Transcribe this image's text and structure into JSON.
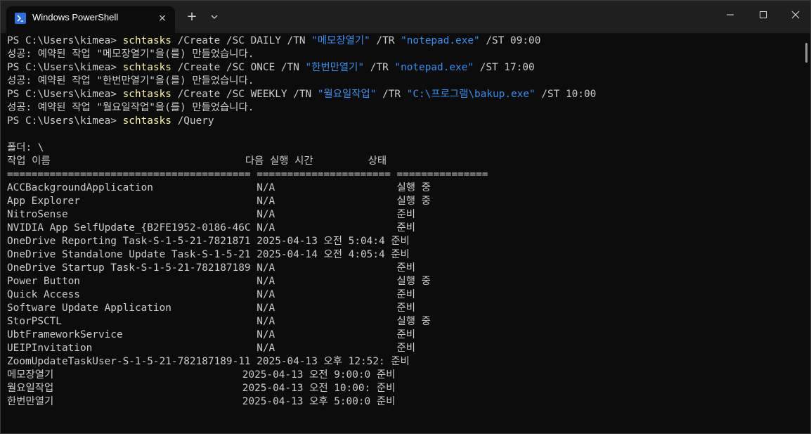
{
  "window": {
    "tab_title": "Windows PowerShell",
    "tab_close_icon": "×",
    "new_tab_icon": "+",
    "dropdown_icon": "chevron-down-icon",
    "controls": [
      "minimize-icon",
      "maximize-icon",
      "close-icon"
    ]
  },
  "colors": {
    "background": "#0c0c0c",
    "text": "#cccccc",
    "command": "#f9f1a5",
    "string": "#3b8eea",
    "titlebar": "#1f1f1f"
  },
  "terminal": {
    "lines": [
      {
        "segments": [
          {
            "text": "PS C:\\Users\\kimea> ",
            "style": "plain"
          },
          {
            "text": "schtasks",
            "style": "cmd"
          },
          {
            "text": " /Create /SC DAILY /TN ",
            "style": "plain"
          },
          {
            "text": "\"메모장열기\"",
            "style": "str"
          },
          {
            "text": " /TR ",
            "style": "plain"
          },
          {
            "text": "\"notepad.exe\"",
            "style": "str"
          },
          {
            "text": " /ST 09:00",
            "style": "plain"
          }
        ]
      },
      {
        "segments": [
          {
            "text": "성공: 예약된 작업 \"메모장열기\"을(를) 만들었습니다.",
            "style": "plain"
          }
        ]
      },
      {
        "segments": [
          {
            "text": "PS C:\\Users\\kimea> ",
            "style": "plain"
          },
          {
            "text": "schtasks",
            "style": "cmd"
          },
          {
            "text": " /Create /SC ONCE /TN ",
            "style": "plain"
          },
          {
            "text": "\"한번만열기\"",
            "style": "str"
          },
          {
            "text": " /TR ",
            "style": "plain"
          },
          {
            "text": "\"notepad.exe\"",
            "style": "str"
          },
          {
            "text": " /ST 17:00",
            "style": "plain"
          }
        ]
      },
      {
        "segments": [
          {
            "text": "성공: 예약된 작업 \"한번만열기\"을(를) 만들었습니다.",
            "style": "plain"
          }
        ]
      },
      {
        "segments": [
          {
            "text": "PS C:\\Users\\kimea> ",
            "style": "plain"
          },
          {
            "text": "schtasks",
            "style": "cmd"
          },
          {
            "text": " /Create /SC WEEKLY /TN ",
            "style": "plain"
          },
          {
            "text": "\"월요일작업\"",
            "style": "str"
          },
          {
            "text": " /TR ",
            "style": "plain"
          },
          {
            "text": "\"C:\\프로그램\\bakup.exe\"",
            "style": "str"
          },
          {
            "text": " /ST 10:00",
            "style": "plain"
          }
        ]
      },
      {
        "segments": [
          {
            "text": "성공: 예약된 작업 \"월요일작업\"을(를) 만들었습니다.",
            "style": "plain"
          }
        ]
      },
      {
        "segments": [
          {
            "text": "PS C:\\Users\\kimea> ",
            "style": "plain"
          },
          {
            "text": "schtasks",
            "style": "cmd"
          },
          {
            "text": " /Query",
            "style": "plain"
          }
        ]
      },
      {
        "segments": [
          {
            "text": "",
            "style": "plain"
          }
        ]
      },
      {
        "segments": [
          {
            "text": "폴더: \\",
            "style": "plain"
          }
        ]
      },
      {
        "segments": [
          {
            "text": "작업 이름                                다음 실행 시간         상태",
            "style": "plain"
          }
        ]
      },
      {
        "segments": [
          {
            "text": "======================================== ====================== ===============",
            "style": "plain"
          }
        ]
      },
      {
        "segments": [
          {
            "text": "ACCBackgroundApplication                 N/A                    실행 중",
            "style": "plain"
          }
        ]
      },
      {
        "segments": [
          {
            "text": "App Explorer                             N/A                    실행 중",
            "style": "plain"
          }
        ]
      },
      {
        "segments": [
          {
            "text": "NitroSense                               N/A                    준비",
            "style": "plain"
          }
        ]
      },
      {
        "segments": [
          {
            "text": "NVIDIA App SelfUpdate_{B2FE1952-0186-46C N/A                    준비",
            "style": "plain"
          }
        ]
      },
      {
        "segments": [
          {
            "text": "OneDrive Reporting Task-S-1-5-21-7821871 2025-04-13 오전 5:04:4 준비",
            "style": "plain"
          }
        ]
      },
      {
        "segments": [
          {
            "text": "OneDrive Standalone Update Task-S-1-5-21 2025-04-14 오전 4:05:4 준비",
            "style": "plain"
          }
        ]
      },
      {
        "segments": [
          {
            "text": "OneDrive Startup Task-S-1-5-21-782187189 N/A                    준비",
            "style": "plain"
          }
        ]
      },
      {
        "segments": [
          {
            "text": "Power Button                             N/A                    실행 중",
            "style": "plain"
          }
        ]
      },
      {
        "segments": [
          {
            "text": "Quick Access                             N/A                    준비",
            "style": "plain"
          }
        ]
      },
      {
        "segments": [
          {
            "text": "Software Update Application              N/A                    준비",
            "style": "plain"
          }
        ]
      },
      {
        "segments": [
          {
            "text": "StorPSCTL                                N/A                    실행 중",
            "style": "plain"
          }
        ]
      },
      {
        "segments": [
          {
            "text": "UbtFrameworkService                      N/A                    준비",
            "style": "plain"
          }
        ]
      },
      {
        "segments": [
          {
            "text": "UEIPInvitation                           N/A                    준비",
            "style": "plain"
          }
        ]
      },
      {
        "segments": [
          {
            "text": "ZoomUpdateTaskUser-S-1-5-21-782187189-11 2025-04-13 오후 12:52: 준비",
            "style": "plain"
          }
        ]
      },
      {
        "segments": [
          {
            "text": "메모장열기                               2025-04-13 오전 9:00:0 준비",
            "style": "plain"
          }
        ]
      },
      {
        "segments": [
          {
            "text": "월요일작업                               2025-04-13 오전 10:00: 준비",
            "style": "plain"
          }
        ]
      },
      {
        "segments": [
          {
            "text": "한번만열기                               2025-04-13 오후 5:00:0 준비",
            "style": "plain"
          }
        ]
      }
    ]
  }
}
